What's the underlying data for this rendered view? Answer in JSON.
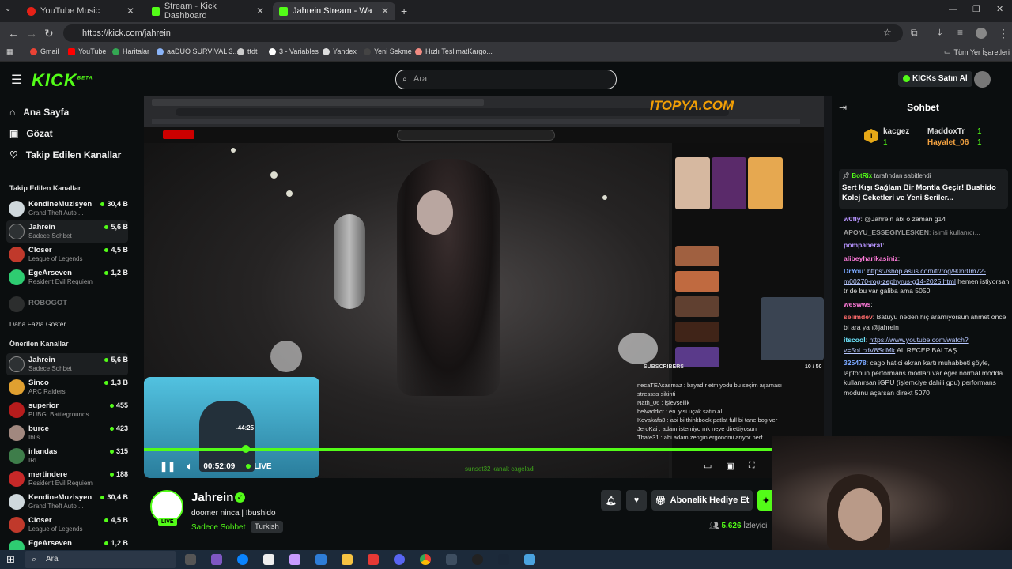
{
  "browser": {
    "tabs": [
      {
        "title": "YouTube Music",
        "color": "#e62117",
        "active": false
      },
      {
        "title": "Stream - Kick Dashboard",
        "color": "#53fc18",
        "active": false
      },
      {
        "title": "Jahrein Stream - Watch Live",
        "color": "#53fc18",
        "active": true
      }
    ],
    "url": "https://kick.com/jahrein",
    "bookmarks": [
      "Gmail",
      "YouTube",
      "Haritalar",
      "aaDUO SURVIVAL 3...",
      "ttdt",
      "3 - Variables",
      "Yandex",
      "Yeni Sekme",
      "Hızlı TeslimatKargo..."
    ],
    "all_bookmarks": "Tüm Yer İşaretleri"
  },
  "kick": {
    "logo": "KICK",
    "logo_badge": "BETA",
    "search_placeholder": "Ara",
    "buy_kicks": "KICKs Satın Al"
  },
  "sidebar": {
    "nav": [
      "Ana Sayfa",
      "Gözat",
      "Takip Edilen Kanallar"
    ],
    "followed_heading": "Takip Edilen Kanallar",
    "followed": [
      {
        "name": "KendineMuzisyen",
        "game": "Grand Theft Auto ...",
        "viewers": "30,4 B"
      },
      {
        "name": "Jahrein",
        "game": "Sadece Sohbet",
        "viewers": "5,6 B"
      },
      {
        "name": "Closer",
        "game": "League of Legends",
        "viewers": "4,5 B"
      },
      {
        "name": "EgeArseven",
        "game": "Resident Evil Requiem",
        "viewers": "1,2 B"
      },
      {
        "name": "ROBOGOT",
        "game": "",
        "viewers": ""
      }
    ],
    "show_more": "Daha Fazla Göster",
    "recommended_heading": "Önerilen Kanallar",
    "recommended": [
      {
        "name": "Jahrein",
        "game": "Sadece Sohbet",
        "viewers": "5,6 B"
      },
      {
        "name": "Sinco",
        "game": "ARC Raiders",
        "viewers": "1,3 B"
      },
      {
        "name": "superior",
        "game": "PUBG: Battlegrounds",
        "viewers": "455"
      },
      {
        "name": "burce",
        "game": "Iblis",
        "viewers": "423"
      },
      {
        "name": "irlandas",
        "game": "IRL",
        "viewers": "315"
      },
      {
        "name": "mertindere",
        "game": "Resident Evil Requiem",
        "viewers": "188"
      },
      {
        "name": "KendineMuzisyen",
        "game": "Grand Theft Auto ...",
        "viewers": "30,4 B"
      },
      {
        "name": "Closer",
        "game": "League of Legends",
        "viewers": "4,5 B"
      },
      {
        "name": "EgeArseven",
        "game": "",
        "viewers": "1,2 B"
      }
    ]
  },
  "player": {
    "overlay_logo": "ITOPYA.COM",
    "time": "00:52:09",
    "live": "LIVE",
    "hover_time": "-44:25",
    "progress": 1.0,
    "overlay_chat": [
      "necaTEAsasmaz : bayadır etmiyodu bu seçim aşaması",
      "stressss sikinti",
      "Nath_06 : işlevsellik",
      "helvaddict : en iyisi uçak satın al",
      "Kovakafa8 : abi bi thinkbook patlat full bi tane boş ver",
      "JeroKai : adam istemiyo mk neye direttiyosun",
      "Tbate31 : abi adam zengin ergonomi arıyor perf"
    ],
    "subscribers_label": "SUBSCRIBERS",
    "subscribers_count": "10 / 50",
    "bottom_text": "sunset32 kanak cageladi"
  },
  "stream": {
    "channel": "Jahrein",
    "title": "doomer ninca | !bushido",
    "category": "Sadece Sohbet",
    "language": "Turkish",
    "live_badge": "LIVE",
    "subscribe_gift": "Abonelik Hediye Et",
    "viewers": "5.626",
    "viewers_label": "İzleyici"
  },
  "chat": {
    "title": "Sohbet",
    "top_gifters": [
      {
        "name": "kacgez",
        "count": "1"
      },
      {
        "name": "MaddoxTr",
        "count": "1"
      },
      {
        "name": "Hayalet_06",
        "count": "1"
      }
    ],
    "pinned_by": "BotRix",
    "pinned_suffix": "tarafından sabitlendi",
    "pinned_text": "Sert Kışı Sağlam Bir Montla Geçir! Bushido Kolej Ceketleri ve Yeni Seriler...",
    "messages": [
      {
        "user": "w0fly",
        "color": "#b794ff",
        "text": "@Jahrein abi o zaman g14"
      },
      {
        "user": "APOYU_ESSEGIYLESKEN",
        "color": "#9a9a9a",
        "text": "isimli kullanıcı..."
      },
      {
        "user": "pompaberat",
        "color": "#b794ff",
        "text": ""
      },
      {
        "user": "alibeyharikasiniz",
        "color": "#ff7ad9",
        "text": ""
      },
      {
        "user": "DrYou",
        "color": "#7aa8ff",
        "text": "",
        "link": "https://shop.asus.com/tr/rog/90nr0m72-m00270-rog-zephyrus-g14-2025.html",
        "after": "hemen istiyorsan tr de bu var galiba ama 5050"
      },
      {
        "user": "weswws",
        "color": "#ff7ad9",
        "text": ""
      },
      {
        "user": "selimdev",
        "color": "#ff6b6b",
        "text": "Batuyu neden hiç aramıyorsun ahmet önce bi ara ya @jahrein"
      },
      {
        "user": "itscool",
        "color": "#6ee7ff",
        "text": "",
        "link": "https://www.youtube.com/watch?v=5oLcdV8SdMk",
        "after": "AL RECEP BALTAŞ"
      },
      {
        "user": "325478",
        "color": "#7aa8ff",
        "text": "cago hatici ekran kartı muhabbeti şöyle, laptopun performans modları var eğer normal modda kullanırsan iGPU (işlemciye dahili gpu) performans modunu açarsan direkt 5070"
      }
    ]
  },
  "taskbar": {
    "search_placeholder": "Ara"
  }
}
